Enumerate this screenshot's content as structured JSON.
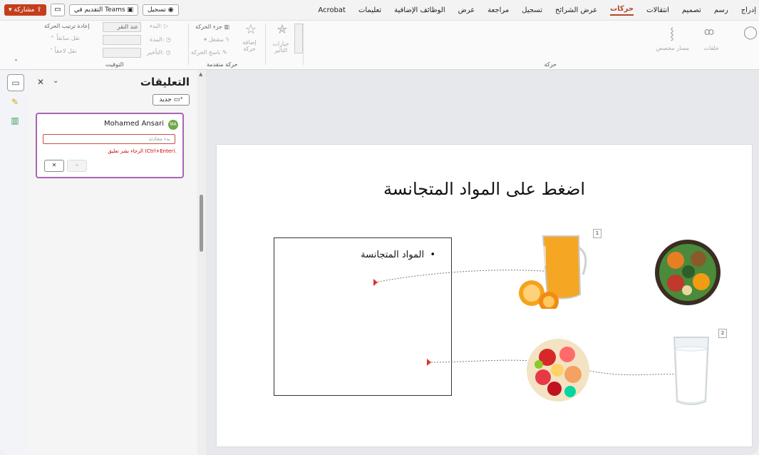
{
  "tabs": [
    "إدراج",
    "رسم",
    "تصميم",
    "انتقالات",
    "حركات",
    "عرض الشرائح",
    "تسجيل",
    "مراجعة",
    "عرض",
    "الوظائف الإضافية",
    "تعليمات",
    "Acrobat"
  ],
  "active_tab": "حركات",
  "topbar": {
    "share_label": "مشاركة",
    "teams_label": "التقديم في Teams",
    "record_label": "تسجيل"
  },
  "ribbon": {
    "group_animation_label": "حركة",
    "group_advanced_label": "حركة متقدمة",
    "group_timing_label": "التوقيت",
    "custom_path_label": "مسار مخصص",
    "loops_label": "حلقات",
    "effect_options_label": "خيارات التأثير",
    "add_animation_label": "إضافة حركة",
    "animation_pane_label": "جزء الحركة",
    "trigger_label": "مشغل",
    "painter_label": "ناسخ الحركة",
    "start_label": "البدء:",
    "start_value": "عند النقر",
    "duration_label": "المدة:",
    "delay_label": "التأخير:",
    "reorder_label": "إعادة ترتيب الحركة",
    "move_earlier_label": "نقل سابقاً",
    "move_later_label": "نقل لاحقاً"
  },
  "comments": {
    "title": "التعليقات",
    "new_label": "جديد",
    "author": "Mohamed Ansari",
    "avatar_initials": "MA",
    "input_placeholder": "بدء محادثة",
    "error_text": "الرجاء نشر تعليق (Ctrl+Enter).",
    "post_icon": "send-icon",
    "cancel_icon": "close-icon"
  },
  "slide": {
    "title": "اضغط على المواد المتجانسة",
    "bullet": "المواد المتجانسة",
    "marker_1": "1",
    "marker_2": "2"
  },
  "colors": {
    "accent": "#b7472a",
    "share": "#c43e1c",
    "comment_border": "#a865b5",
    "error": "#cc0000",
    "avatar": "#6ea84a"
  }
}
